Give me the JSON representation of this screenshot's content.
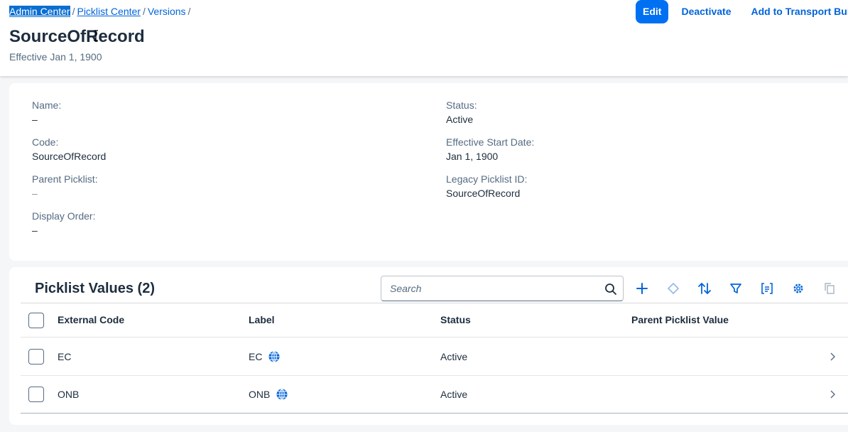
{
  "breadcrumb": {
    "items": [
      "Admin Center",
      "Picklist Center",
      "Versions"
    ],
    "separator": "/"
  },
  "header": {
    "title": "SourceOfRecord",
    "subtitle": "Effective Jan 1, 1900",
    "actions": {
      "edit": "Edit",
      "deactivate": "Deactivate",
      "transport": "Add to Transport Bundle"
    }
  },
  "details": {
    "name_label": "Name:",
    "name_value": "–",
    "code_label": "Code:",
    "code_value": "SourceOfRecord",
    "parent_label": "Parent Picklist:",
    "parent_value": "–",
    "order_label": "Display Order:",
    "order_value": "–",
    "status_label": "Status:",
    "status_value": "Active",
    "start_label": "Effective Start Date:",
    "start_value": "Jan 1, 1900",
    "legacy_label": "Legacy Picklist ID:",
    "legacy_value": "SourceOfRecord"
  },
  "table": {
    "title": "Picklist Values (2)",
    "search_placeholder": "Search",
    "columns": [
      "External Code",
      "Label",
      "Status",
      "Parent Picklist Value"
    ],
    "rows": [
      {
        "external_code": "EC",
        "label": "EC",
        "status": "Active",
        "parent": ""
      },
      {
        "external_code": "ONB",
        "label": "ONB",
        "status": "Active",
        "parent": ""
      }
    ],
    "toolbar_icons": [
      "add-icon",
      "diamond-icon",
      "sort-icon",
      "filter-icon",
      "group-icon",
      "settings-icon",
      "copy-icon"
    ]
  },
  "colors": {
    "accent": "#0070f2",
    "link": "#0064d9",
    "text": "#1d2d3e",
    "muted": "#556b82",
    "background": "#f5f6f7"
  }
}
